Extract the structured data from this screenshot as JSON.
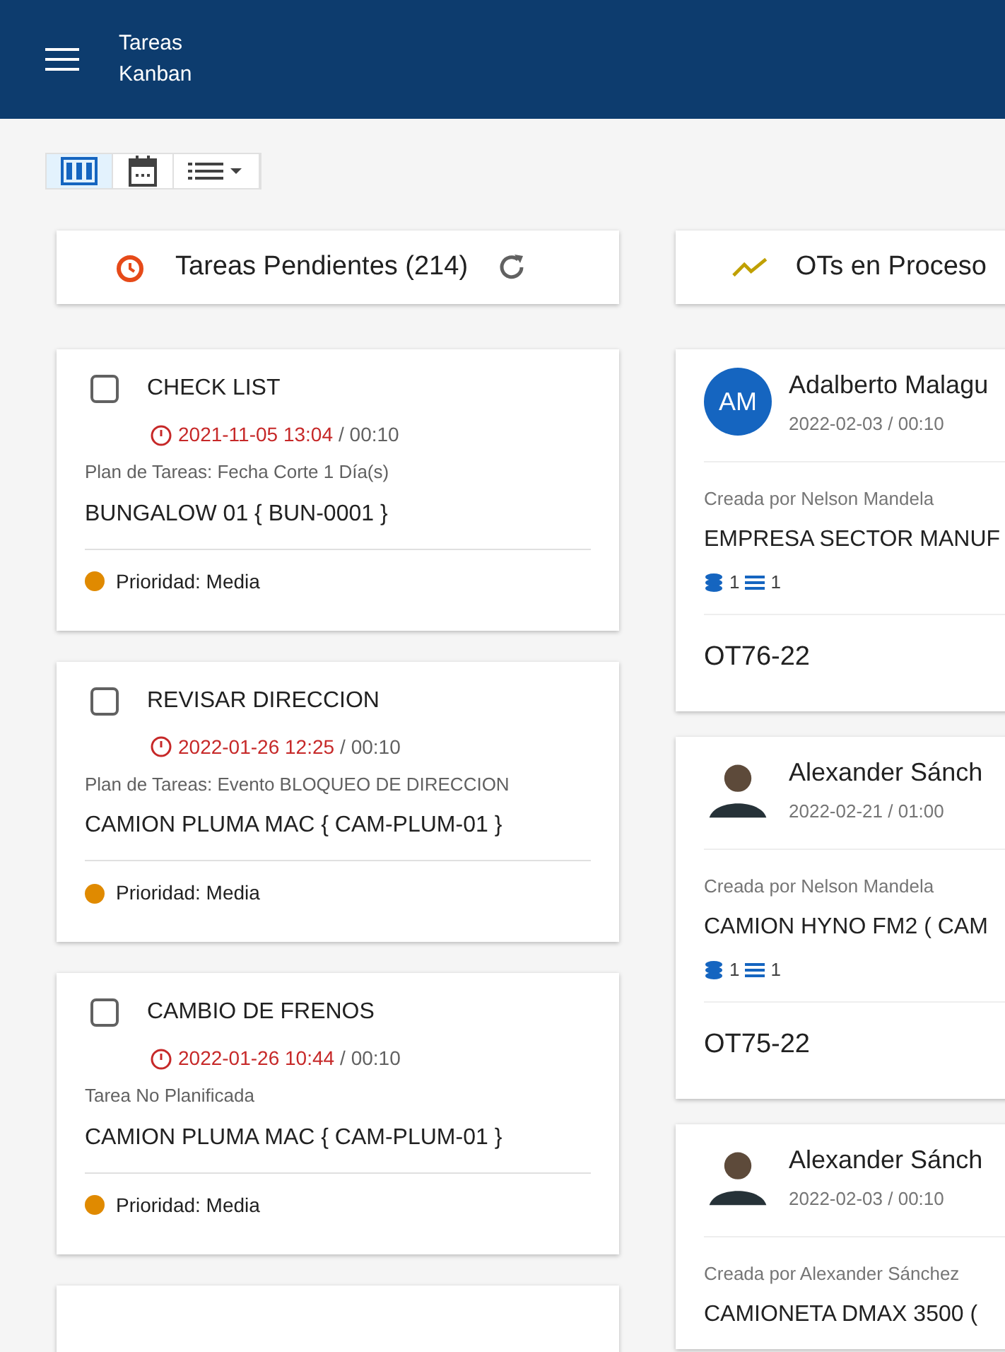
{
  "app_bar": {
    "title_lines": [
      "Tareas",
      "Kanban"
    ]
  },
  "view_toggle": [
    {
      "kind": "kanban",
      "selected": true
    },
    {
      "kind": "calendar",
      "selected": false
    },
    {
      "kind": "list",
      "selected": false
    }
  ],
  "columns": [
    {
      "kind": "pending",
      "title": "Tareas Pendientes (214)",
      "cards": [
        {
          "title": "CHECK LIST",
          "checked": false,
          "date": "2021-11-05 13:04",
          "duration": "/ 00:10",
          "origin": "Plan de Tareas: Fecha Corte 1 Día(s)",
          "asset": "BUNGALOW 01 { BUN-0001 }",
          "priority": "Prioridad: Media",
          "color": "#e08a00"
        },
        {
          "title": "REVISAR DIRECCION",
          "checked": false,
          "date": "2022-01-26 12:25",
          "duration": "/ 00:10",
          "origin": "Plan de Tareas: Evento BLOQUEO DE DIRECCION",
          "asset": "CAMION PLUMA MAC { CAM-PLUM-01 }",
          "priority": "Prioridad: Media",
          "color": "#e08a00"
        },
        {
          "title": "CAMBIO DE FRENOS",
          "checked": false,
          "date": "2022-01-26 10:44",
          "duration": "/ 00:10",
          "origin": "Tarea No Planificada",
          "asset": "CAMION PLUMA MAC { CAM-PLUM-01 }",
          "priority": "Prioridad: Media",
          "color": "#e08a00"
        }
      ]
    },
    {
      "kind": "progress",
      "title": "OTs en Proceso",
      "cards": [
        {
          "avatar": {
            "kind": "initials",
            "text": "AM"
          },
          "name": "Adalberto Malagu",
          "date": "2022-02-03 / 00:10",
          "creator": "Creada por Nelson Mandela",
          "asset": "EMPRESA SECTOR MANUF",
          "stock_count": "1",
          "task_count": "1",
          "code": "OT76-22"
        },
        {
          "avatar": {
            "kind": "photo"
          },
          "name": "Alexander Sánch",
          "date": "2022-02-21 / 01:00",
          "creator": "Creada por Nelson Mandela",
          "asset": "CAMION HYNO FM2 ( CAM",
          "stock_count": "1",
          "task_count": "1",
          "code": "OT75-22"
        },
        {
          "avatar": {
            "kind": "photo"
          },
          "name": "Alexander Sánch",
          "date": "2022-02-03 / 00:10",
          "creator": "Creada por Alexander Sánchez",
          "asset": "CAMIONETA DMAX 3500 ("
        }
      ]
    }
  ]
}
